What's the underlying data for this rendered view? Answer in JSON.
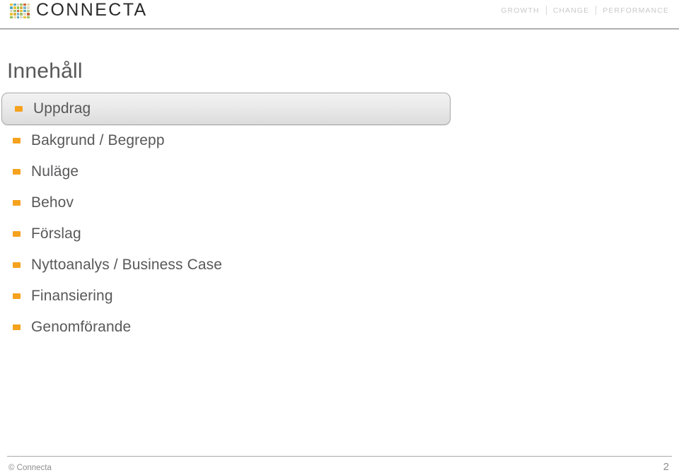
{
  "header": {
    "brand_name": "CONNECTA",
    "logo_icon": "connecta-grid-logo",
    "logo_colors": [
      "#e8c23a",
      "#5aa9c4",
      "#d9d6c0",
      "#9fbf6a",
      "#c96a3a",
      "#e8d9a8",
      "#5aa9c4",
      "#e8c23a",
      "#8fbf5a",
      "#d9b24a",
      "#7fb8c9",
      "#e0dcc4",
      "#d9d6c0",
      "#9fbf6a",
      "#c96a3a",
      "#e8c23a",
      "#5aa9c4",
      "#b5cf8a",
      "#e8c23a",
      "#d9b24a",
      "#7fb8c9",
      "#9fbf6a",
      "#e0dcc4",
      "#c96a3a",
      "#8fbf5a",
      "#e8d9a8",
      "#5aa9c4",
      "#d9d6c0",
      "#e8c23a",
      "#9fbf6a"
    ],
    "tagline": {
      "growth": "GROWTH",
      "change": "CHANGE",
      "performance": "PERFORMANCE"
    }
  },
  "slide": {
    "title": "Innehåll",
    "agenda": [
      {
        "label": "Uppdrag",
        "highlighted": true,
        "bullet_color": "#f5a21e"
      },
      {
        "label": "Bakgrund / Begrepp",
        "highlighted": false,
        "bullet_color": "#f5a21e"
      },
      {
        "label": "Nuläge",
        "highlighted": false,
        "bullet_color": "#f5a21e"
      },
      {
        "label": "Behov",
        "highlighted": false,
        "bullet_color": "#f5a21e"
      },
      {
        "label": "Förslag",
        "highlighted": false,
        "bullet_color": "#f5a21e"
      },
      {
        "label": "Nyttoanalys / Business Case",
        "highlighted": false,
        "bullet_color": "#f5a21e"
      },
      {
        "label": "Finansiering",
        "highlighted": false,
        "bullet_color": "#f5a21e"
      },
      {
        "label": "Genomförande",
        "highlighted": false,
        "bullet_color": "#f5a21e"
      }
    ]
  },
  "footer": {
    "copyright": "© Connecta",
    "page_number": "2"
  },
  "colors": {
    "accent_orange": "#f5a21e",
    "text_gray": "#58585a",
    "muted_gray": "#8e8e8e",
    "rule_gray": "#a9a9a9",
    "background": "#ffffff"
  }
}
